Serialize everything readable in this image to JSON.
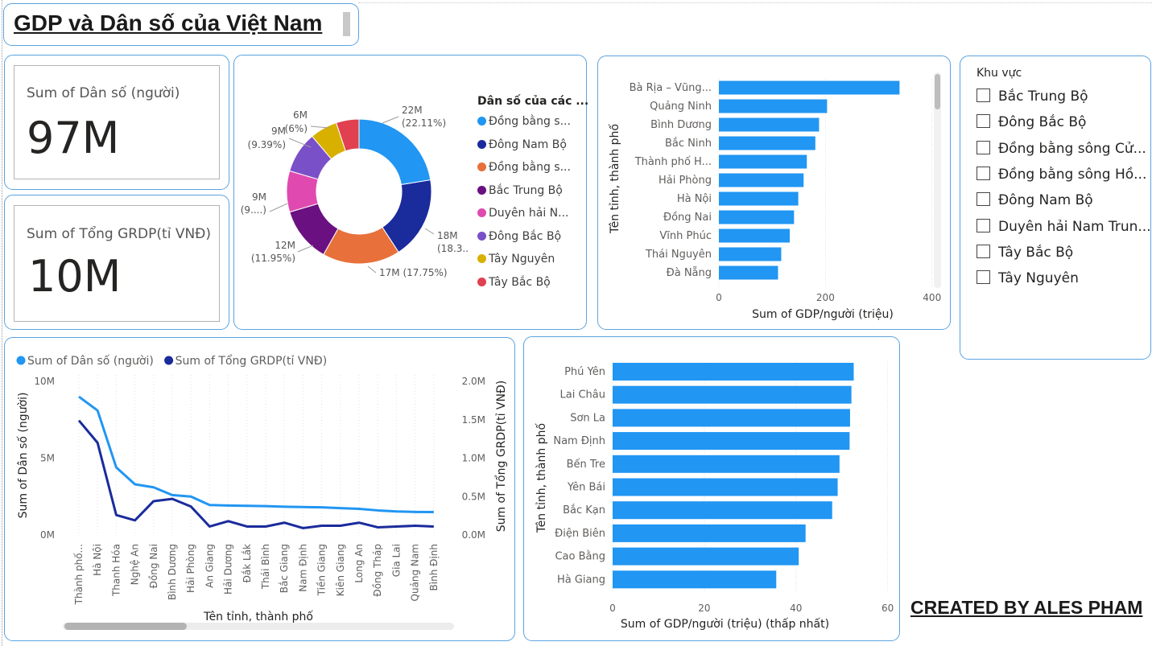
{
  "title": "GDP và Dân số của Việt Nam",
  "cards": {
    "population": {
      "label": "Sum of Dân số (người)",
      "value": "97M"
    },
    "grdp": {
      "label": "Sum of Tổng GRDP(tỉ VNĐ)",
      "value": "10M"
    }
  },
  "donut": {
    "legend_title": "Dân số của các ...",
    "slices": [
      {
        "legend": "Đồng bằng s...",
        "value": 22,
        "percent": 22.11,
        "color": "#2196f3",
        "label_top": "22M",
        "label_bottom": "(22.11%)"
      },
      {
        "legend": "Đông Nam Bộ",
        "value": 18,
        "percent": 18.3,
        "color": "#1a2b9c",
        "label_top": "18M",
        "label_bottom": "(18.3...)"
      },
      {
        "legend": "Đồng bằng s...",
        "value": 17,
        "percent": 17.75,
        "color": "#e8703a",
        "label_top": "17M (17.75%)",
        "label_bottom": ""
      },
      {
        "legend": "Bắc Trung Bộ",
        "value": 12,
        "percent": 11.95,
        "color": "#6a1080",
        "label_top": "12M",
        "label_bottom": "(11.95%)"
      },
      {
        "legend": "Duyên hải N...",
        "value": 9,
        "percent": 9.0,
        "color": "#e04ab0",
        "label_top": "9M",
        "label_bottom": "(9....)"
      },
      {
        "legend": "Đông Bắc Bộ",
        "value": 9,
        "percent": 9.39,
        "color": "#7a50c8",
        "label_top": "9M",
        "label_bottom": "(9.39%)"
      },
      {
        "legend": "Tây Nguyên",
        "value": 6,
        "percent": 6.0,
        "color": "#d8b000",
        "label_top": "6M",
        "label_bottom": "(6%)"
      },
      {
        "legend": "Tây Bắc Bộ",
        "value": 5,
        "percent": 5.4,
        "color": "#e04050",
        "label_top": "",
        "label_bottom": ""
      }
    ]
  },
  "top_gdp": {
    "ylabel": "Tên tỉnh, thành phố",
    "xlabel": "Sum of GDP/người (triệu)",
    "ticks": [
      "0",
      "200",
      "400"
    ]
  },
  "slicer": {
    "title": "Khu vực",
    "items": [
      "Bắc Trung Bộ",
      "Đông Bắc Bộ",
      "Đồng bằng sông Cử...",
      "Đồng bằng sông Hồ...",
      "Đông Nam Bộ",
      "Duyên hải Nam Trun...",
      "Tây Bắc Bộ",
      "Tây Nguyên"
    ]
  },
  "line": {
    "legend": [
      {
        "name": "Sum of Dân số (người)",
        "color": "#2196f3"
      },
      {
        "name": "Sum of Tổng GRDP(tỉ VNĐ)",
        "color": "#1a2b9c"
      }
    ],
    "ylabel_left": "Sum of Dân số (người)",
    "ylabel_right": "Sum of Tổng GRDP(tỉ VNĐ)",
    "xlabel": "Tên tỉnh, thành phố",
    "left_ticks": [
      "10M",
      "5M",
      "0M"
    ],
    "right_ticks": [
      "2.0M",
      "1.5M",
      "1.0M",
      "0.5M",
      "0.0M"
    ]
  },
  "bottom_gdp": {
    "ylabel": "Tên tỉnh, thành phố",
    "xlabel": "Sum of GDP/người (triệu) (thấp nhất)",
    "ticks": [
      "0",
      "20",
      "40",
      "60"
    ]
  },
  "credit": "CREATED BY ALES PHAM",
  "chart_data": [
    {
      "type": "bar",
      "orientation": "horizontal",
      "ylabel": "Tên tỉnh, thành phố",
      "xlabel": "Sum of GDP/người (triệu)",
      "xlim": [
        0,
        420
      ],
      "grid": true,
      "color": "#2196f3",
      "categories": [
        "Bà Rịa – Vũng...",
        "Quảng Ninh",
        "Bình Dương",
        "Bắc Ninh",
        "Thành phố H...",
        "Hải Phòng",
        "Hà Nội",
        "Đồng Nai",
        "Vĩnh Phúc",
        "Thái Nguyên",
        "Đà Nẵng"
      ],
      "values": [
        339,
        203,
        188,
        181,
        165,
        159,
        149,
        141,
        133,
        117,
        111
      ]
    },
    {
      "type": "line",
      "xlabel": "Tên tỉnh, thành phố",
      "categories": [
        "Thành phố...",
        "Hà Nội",
        "Thanh Hóa",
        "Nghệ An",
        "Đồng Nai",
        "Bình Dương",
        "Hải Phòng",
        "An Giang",
        "Hải Dương",
        "Đắk Lắk",
        "Thái Bình",
        "Bắc Giang",
        "Nam Định",
        "Tiền Giang",
        "Kiên Giang",
        "Long An",
        "Đồng Tháp",
        "Gia Lai",
        "Quảng Nam",
        "Bình Định"
      ],
      "ylim_left": [
        0,
        10000000
      ],
      "ylim_right": [
        0,
        2000000
      ],
      "series": [
        {
          "name": "Sum of Dân số (người)",
          "axis": "left",
          "values": [
            9000000,
            8100000,
            4400000,
            3300000,
            3100000,
            2600000,
            2500000,
            1950000,
            1920000,
            1900000,
            1880000,
            1840000,
            1820000,
            1800000,
            1750000,
            1700000,
            1600000,
            1530000,
            1500000,
            1490000
          ]
        },
        {
          "name": "Sum of Tổng GRDP(tỉ VNĐ)",
          "axis": "right",
          "values": [
            1490000,
            1200000,
            260000,
            190000,
            440000,
            470000,
            370000,
            110000,
            180000,
            110000,
            110000,
            160000,
            90000,
            120000,
            120000,
            160000,
            100000,
            110000,
            120000,
            110000
          ]
        }
      ]
    },
    {
      "type": "bar",
      "orientation": "horizontal",
      "ylabel": "Tên tỉnh, thành phố",
      "xlabel": "Sum of GDP/người (triệu) (thấp nhất)",
      "xlim": [
        0,
        62
      ],
      "grid": true,
      "color": "#2196f3",
      "categories": [
        "Phú Yên",
        "Lai Châu",
        "Sơn La",
        "Nam Định",
        "Bến Tre",
        "Yên Bái",
        "Bắc Kạn",
        "Điện Biên",
        "Cao Bằng",
        "Hà Giang"
      ],
      "values": [
        52.6,
        52.1,
        51.8,
        51.7,
        49.5,
        49.1,
        47.9,
        42.1,
        40.6,
        35.7
      ]
    }
  ]
}
